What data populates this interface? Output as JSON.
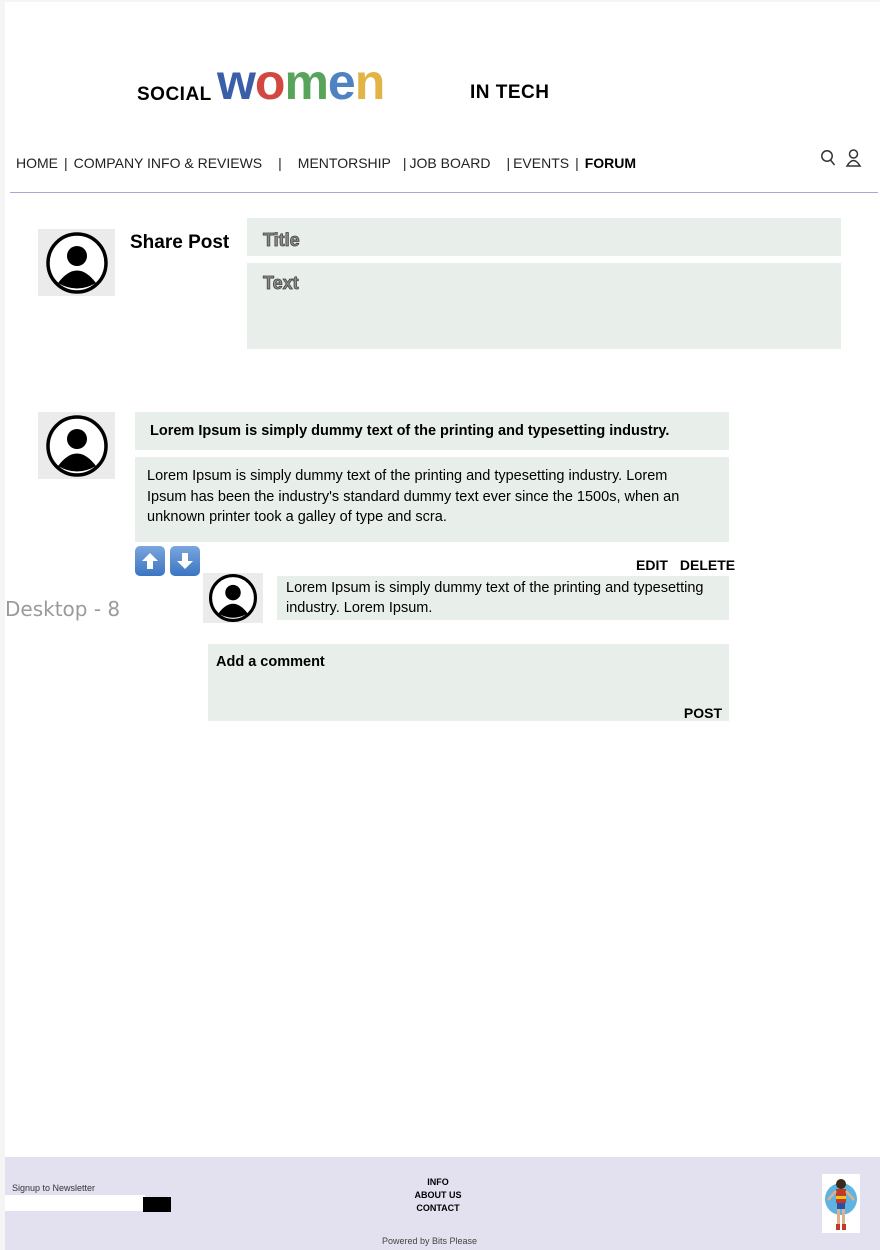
{
  "frame": {
    "label": "Desktop - 8"
  },
  "logo": {
    "left": "SOCIAL",
    "middle_letters": [
      "w",
      "o",
      "m",
      "e",
      "n"
    ],
    "right": "IN TECH"
  },
  "nav": {
    "items": [
      "HOME",
      "COMPANY INFO & REVIEWS",
      "MENTORSHIP",
      "JOB BOARD",
      "EVENTS",
      "FORUM"
    ],
    "separator": "|",
    "active": "FORUM",
    "icons": [
      "search-icon",
      "user-icon"
    ]
  },
  "share": {
    "heading": "Share Post",
    "title_placeholder": "Title",
    "text_placeholder": "Text"
  },
  "post": {
    "title": "Lorem Ipsum is simply dummy text of the printing and typesetting industry.",
    "body": " Lorem Ipsum is simply dummy text of the printing and typesetting industry. Lorem Ipsum has been the industry's standard dummy text ever since the 1500s, when an unknown printer took a galley of type and scra.",
    "edit_label": "EDIT",
    "delete_label": "DELETE",
    "vote_icons": [
      "upvote-arrow-icon",
      "downvote-arrow-icon"
    ]
  },
  "comment": {
    "text": " Lorem Ipsum is simply dummy text of the printing and typesetting industry. Lorem Ipsum."
  },
  "add_comment": {
    "label": "Add a comment",
    "post_label": "POST"
  },
  "footer": {
    "newsletter_label": "Signup to Newsletter",
    "links": [
      "INFO",
      "ABOUT US",
      "CONTACT"
    ],
    "powered": "Powered by Bits Please"
  }
}
